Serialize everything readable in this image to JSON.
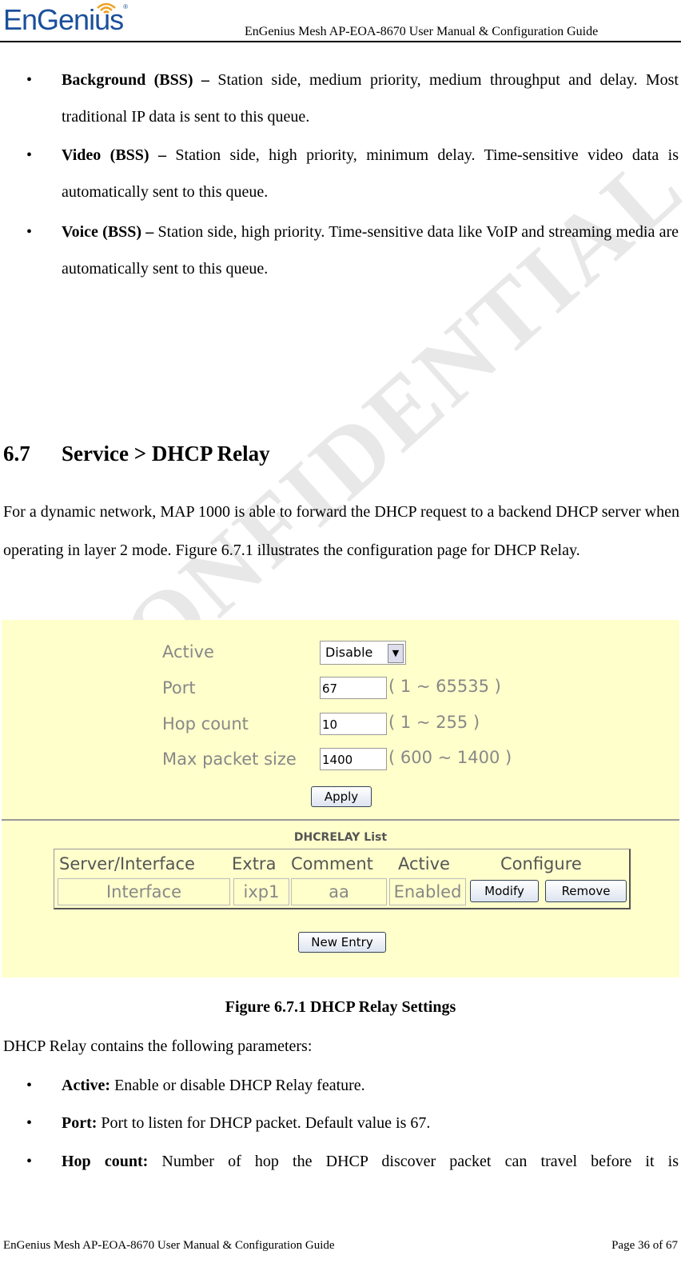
{
  "header": {
    "logo": "EnGenius",
    "title": "EnGenius Mesh AP-EOA-8670 User Manual & Configuration Guide"
  },
  "watermark": "CONFIDENTIAL",
  "bullets_top": [
    {
      "term": "Background (BSS) –",
      "text": " Station side, medium priority, medium throughput and delay. Most traditional IP data is sent to this queue."
    },
    {
      "term": "Video (BSS) –",
      "text": " Station side, high priority, minimum delay. Time-sensitive video data is automatically sent to this queue."
    },
    {
      "term": "Voice (BSS) –",
      "text": " Station side, high priority. Time-sensitive data like VoIP and streaming media are automatically sent to this queue."
    }
  ],
  "section": {
    "number": "6.7",
    "title": "Service > DHCP Relay"
  },
  "intro": "For a dynamic network, MAP 1000 is able to forward the DHCP request to a backend DHCP server when operating in layer 2 mode. Figure 6.7.1 illustrates the configuration page for DHCP Relay.",
  "figure": {
    "form": {
      "active_label": "Active",
      "active_value": "Disable",
      "port_label": "Port",
      "port_value": "67",
      "port_range": "( 1 ~ 65535 )",
      "hop_label": "Hop count",
      "hop_value": "10",
      "hop_range": "( 1 ~ 255 )",
      "max_label": "Max packet size",
      "max_value": "1400",
      "max_range": "( 600 ~ 1400 )",
      "apply": "Apply"
    },
    "list": {
      "title": "DHCRELAY List",
      "headers": [
        "Server/Interface",
        "Extra",
        "Comment",
        "Active",
        "Configure"
      ],
      "row": {
        "server": "Interface",
        "extra": "ixp1",
        "comment": "aa",
        "active": "Enabled",
        "modify": "Modify",
        "remove": "Remove"
      },
      "new_entry": "New Entry"
    }
  },
  "caption": "Figure 6.7.1 DHCP Relay Settings",
  "params_intro": "DHCP Relay contains the following parameters:",
  "bullets_bottom": [
    {
      "term": "Active:",
      "text": " Enable or disable DHCP Relay feature."
    },
    {
      "term": "Port:",
      "text": " Port to listen for DHCP packet. Default value is 67."
    },
    {
      "term": "Hop count:",
      "text": " Number of hop the DHCP discover packet can travel before it is"
    }
  ],
  "footer": {
    "left": "EnGenius Mesh AP-EOA-8670 User Manual & Configuration Guide",
    "right": "Page 36 of 67"
  }
}
